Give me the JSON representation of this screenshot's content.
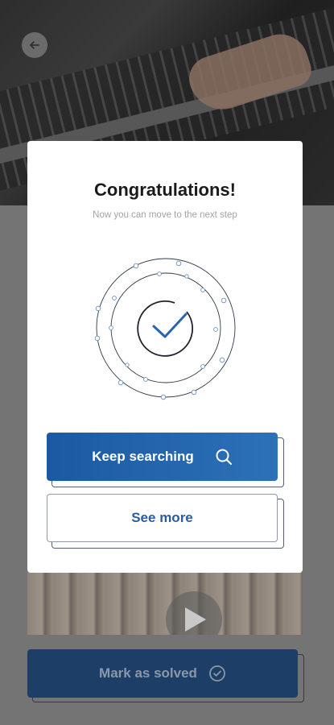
{
  "modal": {
    "title": "Congratulations!",
    "subtitle": "Now you can move to the next step",
    "primary_button": {
      "label": "Keep searching",
      "icon": "search-icon"
    },
    "secondary_button": {
      "label": "See more"
    },
    "illustration": {
      "icon": "check-icon"
    }
  },
  "background": {
    "back_button_icon": "arrow-left-icon",
    "video_icon": "play-icon",
    "solve_button": {
      "label": "Mark as solved",
      "icon": "check-circle-icon"
    }
  },
  "colors": {
    "primary": "#1b5aa3",
    "primary_dark": "#1d3e66",
    "overlay_gray": "#747474",
    "modal_bg": "#ffffff",
    "title": "#1a1a1a",
    "subtitle": "#a3a3a3",
    "link_text": "#2a5d9c"
  }
}
